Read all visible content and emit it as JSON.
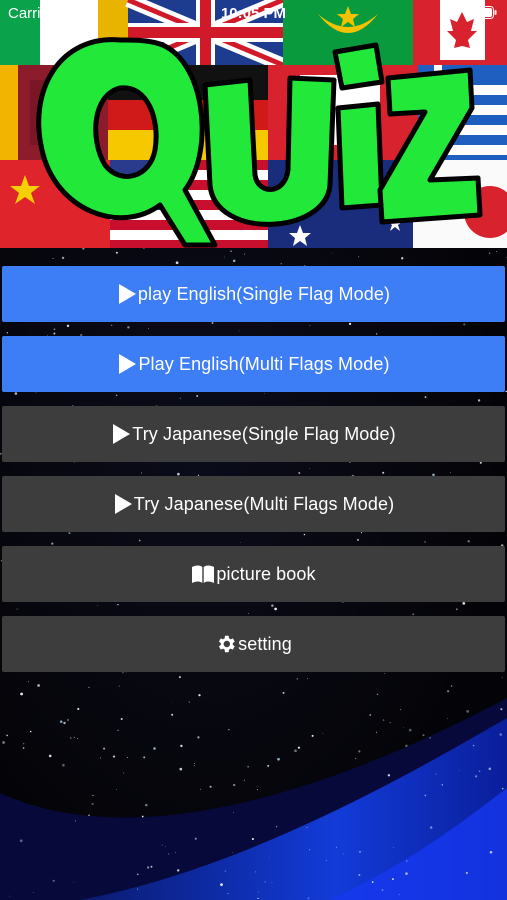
{
  "status_bar": {
    "carrier": "Carrier",
    "time": "10:05 PM"
  },
  "logo": {
    "text": "QUiZ",
    "fill_color": "#22e83a",
    "outline_color": "#000000"
  },
  "menu": {
    "items": [
      {
        "label": "play English(Single Flag Mode)",
        "icon": "play-icon",
        "color": "#3d7df5"
      },
      {
        "label": "Play English(Multi Flags Mode)",
        "icon": "play-icon",
        "color": "#3d7df5"
      },
      {
        "label": "Try Japanese(Single Flag Mode)",
        "icon": "play-icon",
        "color": "#3d3d3d"
      },
      {
        "label": "Try Japanese(Multi Flags Mode)",
        "icon": "play-icon",
        "color": "#3d3d3d"
      },
      {
        "label": "picture book",
        "icon": "book-icon",
        "color": "#3d3d3d"
      },
      {
        "label": "setting",
        "icon": "gear-icon",
        "color": "#3d3d3d"
      }
    ]
  }
}
